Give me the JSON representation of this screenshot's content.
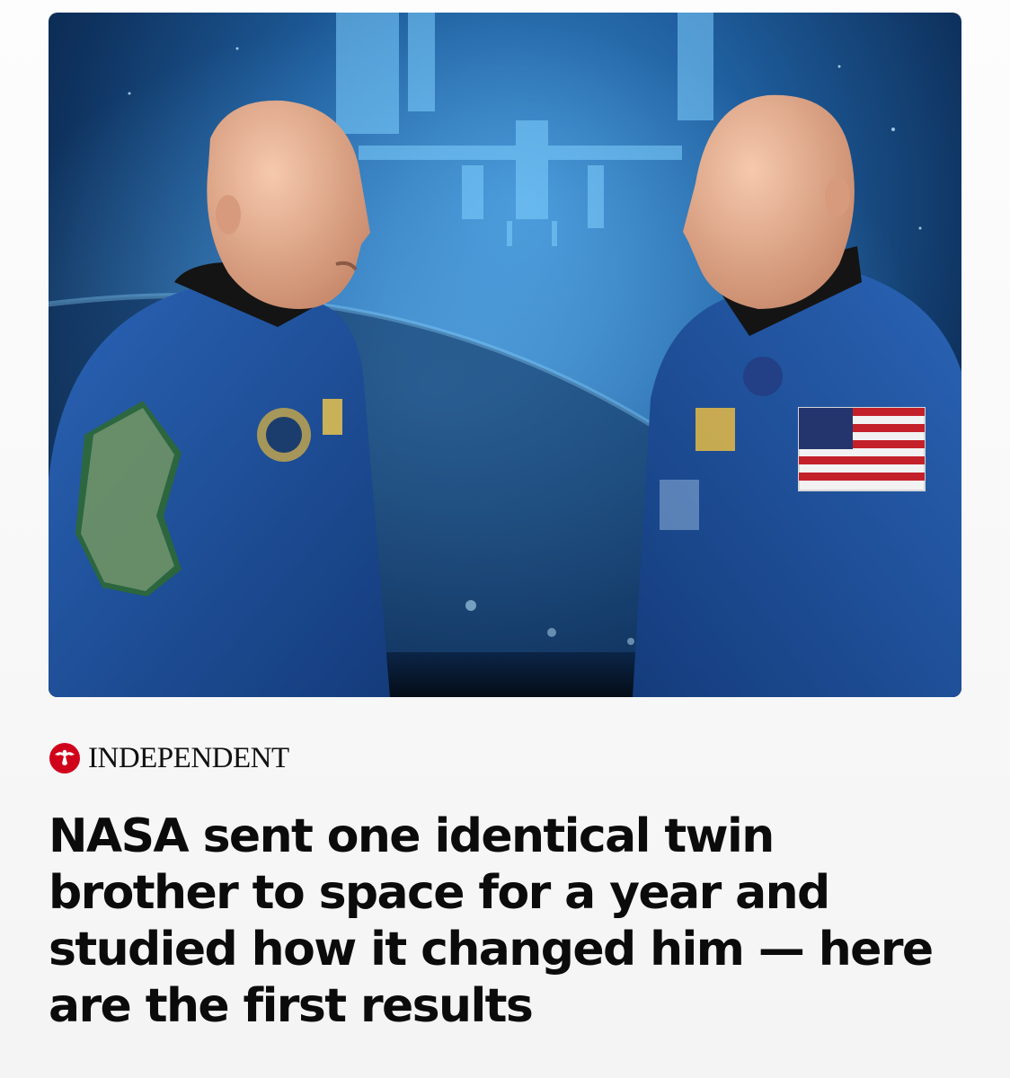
{
  "article": {
    "image_alt": "Identical twin astronauts in blue NASA flight jackets facing each other in front of a projection of the International Space Station",
    "publisher": "INDEPENDENT",
    "headline": "NASA sent one identical twin brother to space for a year and studied how it changed him — here are the first results"
  },
  "colors": {
    "brand_red": "#d0021b",
    "headline": "#0b0b0b",
    "jacket_blue": "#1e4f9a"
  },
  "icons": {
    "publisher_logo": "eagle-roundel-icon"
  }
}
